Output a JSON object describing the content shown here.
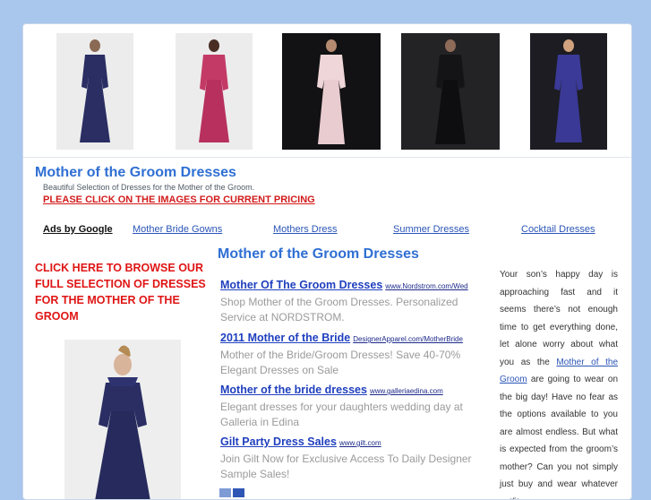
{
  "header": {
    "title": "Mother of the Groom Dresses",
    "subtitle": "Beautiful Selection of Dresses for the Mother of the Groom.",
    "pricing_link": "PLEASE CLICK ON THE IMAGES FOR CURRENT PRICING"
  },
  "ads_nav": {
    "ads_by": "Ads by Google",
    "links": [
      "Mother Bride Gowns",
      "Mothers Dress",
      "Summer Dresses",
      "Cocktail Dresses"
    ]
  },
  "left": {
    "promo": "CLICK HERE TO BROWSE OUR FULL SELECTION OF DRESSES FOR THE MOTHER OF THE GROOM"
  },
  "main": {
    "title": "Mother of the Groom Dresses",
    "ads": [
      {
        "title": "Mother Of The Groom Dresses",
        "url": "www.Nordstrom.com/Wed",
        "desc": "Shop Mother of the Groom Dresses. Personalized Service at NORDSTROM."
      },
      {
        "title": "2011 Mother of the Bride",
        "url": "DesignerApparel.com/MotherBride",
        "desc": "Mother of the Bride/Groom Dresses! Save 40-70% Elegant Dresses on Sale"
      },
      {
        "title": "Mother of the bride dresses",
        "url": "www.galleriaedina.com",
        "desc": "Elegant dresses for your daughters wedding day at Galleria in Edina"
      },
      {
        "title": "Gilt Party Dress Sales",
        "url": "www.gilt.com",
        "desc": "Join Gilt Now for Exclusive Access To Daily Designer Sample Sales!"
      }
    ]
  },
  "right": {
    "text_before": "Your son’s happy day is approaching fast and it seems there’s not enough time to get everything done, let alone worry about what you as the",
    "link": "Mother of the Groom",
    "text_after": "are going to wear on the big day! Have no fear as the options available to you are almost endless. But what is expected from the groom’s mother? Can you not simply just buy and wear whatever outfit you"
  },
  "colors": {
    "background": "#a9c6ec",
    "title_blue": "#2f6fd3",
    "promo_red": "#e01515",
    "link_blue": "#1f3fbe",
    "gown_navy": "#2a2e63",
    "gown_pink": "#c43a67",
    "gown_blush": "#efd6d8",
    "gown_black": "#141416",
    "gown_purple": "#3b3a98"
  },
  "icons": [
    "adchoices-icon"
  ]
}
